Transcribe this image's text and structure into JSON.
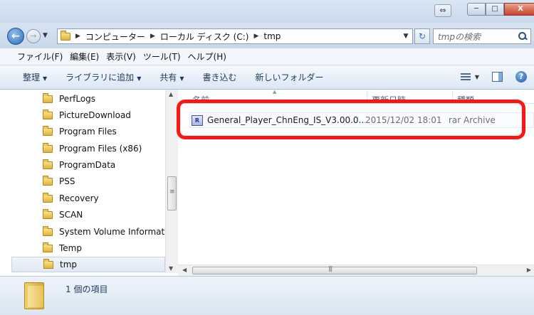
{
  "window": {
    "extra_button": "⇔",
    "min_label": "─",
    "max_label": "□",
    "close_label": "X"
  },
  "address": {
    "back": "←",
    "forward": "→",
    "breadcrumbs": [
      "コンピューター",
      "ローカル ディスク (C:)",
      "tmp"
    ],
    "refresh": "↻",
    "search_placeholder": "tmpの検索"
  },
  "menu": [
    "ファイル(F)",
    "編集(E)",
    "表示(V)",
    "ツール(T)",
    "ヘルプ(H)"
  ],
  "toolbar": {
    "organize": "整理",
    "add_to_library": "ライブラリに追加",
    "share": "共有",
    "burn": "書き込む",
    "new_folder": "新しいフォルダー",
    "help": "?"
  },
  "nav": {
    "items": [
      "PerfLogs",
      "PictureDownload",
      "Program Files",
      "Program Files (x86)",
      "ProgramData",
      "PSS",
      "Recovery",
      "SCAN",
      "System Volume Information",
      "Temp",
      "tmp"
    ],
    "selected": "tmp"
  },
  "columns": {
    "name": "名前",
    "modified": "更新日時",
    "type": "種類"
  },
  "files": [
    {
      "icon": "rar-file-icon",
      "icon_text": "R",
      "name": "General_Player_ChnEng_IS_V3.00.0....",
      "modified": "2015/12/02 18:01",
      "type": "rar Archive"
    }
  ],
  "details": {
    "count_text": "1 個の項目"
  },
  "colors": {
    "highlight": "#ff1414",
    "titlebar": "#c9d9ec"
  }
}
